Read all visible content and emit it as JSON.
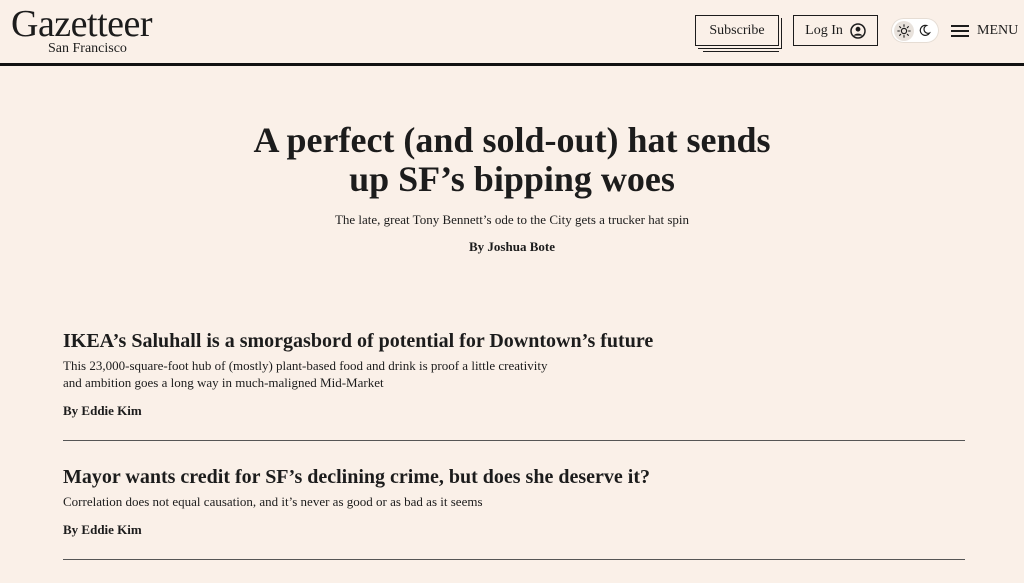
{
  "header": {
    "logo_main": "Gazetteer",
    "logo_sub": "San Francisco",
    "subscribe_label": "Subscribe",
    "login_label": "Log In",
    "menu_label": "MENU",
    "theme_active": "light"
  },
  "lead": {
    "title": "A perfect (and sold-out) hat sends up SF’s bipping woes",
    "subtitle": "The late, great Tony Bennett’s ode to the City gets a trucker hat spin",
    "byline": "By Joshua Bote"
  },
  "stories": [
    {
      "title": "IKEA’s Saluhall is a smorgasbord of potential for Downtown’s future",
      "dek": "This 23,000-square-foot hub of (mostly) plant-based food and drink is proof a little creativity and ambition goes a long way in much-maligned Mid-Market",
      "byline": "By Eddie Kim"
    },
    {
      "title": "Mayor wants credit for SF’s declining crime, but does she deserve it?",
      "dek": "Correlation does not equal causation, and it’s never as good or as bad as it seems",
      "byline": "By Eddie Kim"
    }
  ]
}
